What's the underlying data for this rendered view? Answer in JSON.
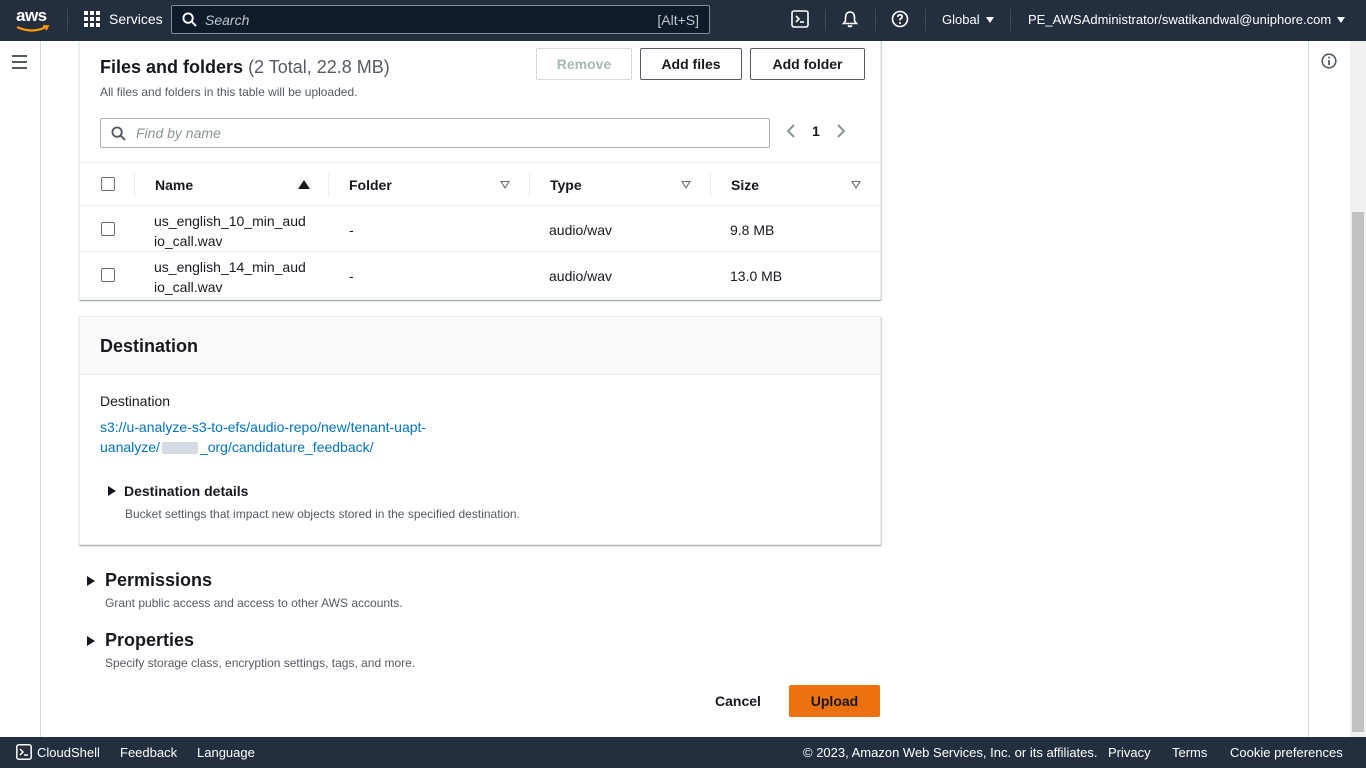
{
  "topnav": {
    "logo_text": "aws",
    "services_label": "Services",
    "search_placeholder": "Search",
    "search_shortcut": "[Alt+S]",
    "region_label": "Global",
    "account_label": "PE_AWSAdministrator/swatikandwal@uniphore.com"
  },
  "files": {
    "title": "Files and folders",
    "count": "(2 Total, 22.8 MB)",
    "description": "All files and folders in this table will be uploaded.",
    "remove_label": "Remove",
    "add_files_label": "Add files",
    "add_folder_label": "Add folder",
    "find_placeholder": "Find by name",
    "page_number": "1",
    "columns": {
      "name": "Name",
      "folder": "Folder",
      "type": "Type",
      "size": "Size"
    },
    "rows": [
      {
        "name_line1": "us_english_10_min_aud",
        "name_line2": "io_call.wav",
        "folder": "-",
        "type": "audio/wav",
        "size": "9.8 MB"
      },
      {
        "name_line1": "us_english_14_min_aud",
        "name_line2": "io_call.wav",
        "folder": "-",
        "type": "audio/wav",
        "size": "13.0 MB"
      }
    ]
  },
  "destination": {
    "title": "Destination",
    "label": "Destination",
    "path_part1": "s3://u-analyze-s3-to-efs/audio-repo/new/tenant-uapt-uanalyze/",
    "path_part2": "_org/candidature_feedback/",
    "details_label": "Destination details",
    "details_desc": "Bucket settings that impact new objects stored in the specified destination."
  },
  "permissions": {
    "label": "Permissions",
    "desc": "Grant public access and access to other AWS accounts."
  },
  "properties": {
    "label": "Properties",
    "desc": "Specify storage class, encryption settings, tags, and more."
  },
  "actions": {
    "cancel_label": "Cancel",
    "upload_label": "Upload"
  },
  "footer": {
    "cloudshell": "CloudShell",
    "feedback": "Feedback",
    "language": "Language",
    "copyright": "© 2023, Amazon Web Services, Inc. or its affiliates.",
    "privacy": "Privacy",
    "terms": "Terms",
    "cookie": "Cookie preferences"
  },
  "colors": {
    "nav_bg": "#232f3e",
    "link": "#0073bb",
    "primary": "#ec7211"
  }
}
